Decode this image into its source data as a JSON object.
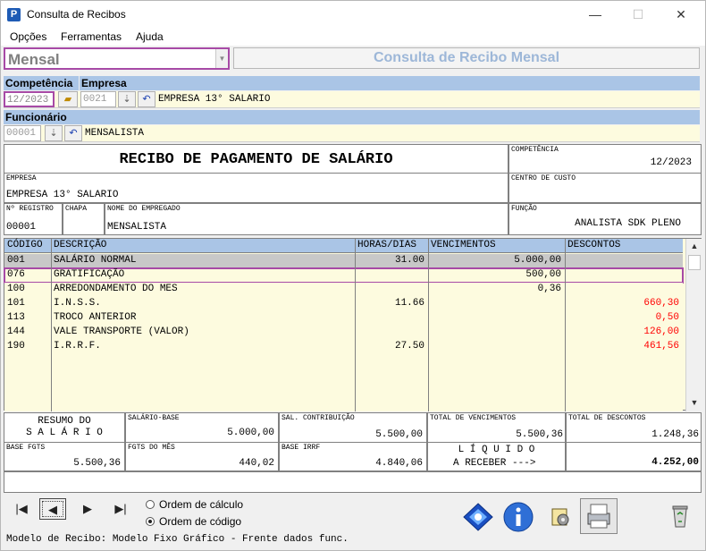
{
  "window": {
    "title": "Consulta de Recibos",
    "minimize": "—",
    "maximize": "☐",
    "close": "✕",
    "app_icon": "P"
  },
  "menu": [
    "Opções",
    "Ferramentas",
    "Ajuda"
  ],
  "period_type": {
    "value": "Mensal"
  },
  "header_title": "Consulta de Recibo Mensal",
  "labels": {
    "competencia": "Competência",
    "empresa": "Empresa",
    "funcionario": "Funcionário"
  },
  "competencia": {
    "value": "12/2023"
  },
  "empresa": {
    "code": "0021",
    "name": "EMPRESA 13° SALARIO"
  },
  "funcionario": {
    "code": "00001",
    "name": "MENSALISTA"
  },
  "receipt": {
    "title": "RECIBO DE PAGAMENTO DE SALÁRIO",
    "competencia_label": "COMPETÊNCIA",
    "competencia_value": "12/2023",
    "empresa_label": "EMPRESA",
    "empresa_value": "EMPRESA 13° SALARIO",
    "centro_label": "CENTRO DE CUSTO",
    "registro_label": "Nº REGISTRO",
    "registro_value": "00001",
    "chapa_label": "CHAPA",
    "nome_label": "NOME DO EMPREGADO",
    "nome_value": "MENSALISTA",
    "funcao_label": "FUNÇÃO",
    "funcao_value": "ANALISTA SDK PLENO"
  },
  "table": {
    "headers": [
      "CÓDIGO",
      "DESCRIÇÃO",
      "HORAS/DIAS",
      "VENCIMENTOS",
      "DESCONTOS"
    ],
    "rows": [
      {
        "code": "001",
        "desc": "SALÁRIO NORMAL",
        "hours": "31.00",
        "venc": "5.000,00",
        "desc_val": ""
      },
      {
        "code": "076",
        "desc": "GRATIFICAÇÃO",
        "hours": "",
        "venc": "500,00",
        "desc_val": ""
      },
      {
        "code": "100",
        "desc": "ARREDONDAMENTO DO MES",
        "hours": "",
        "venc": "0,36",
        "desc_val": ""
      },
      {
        "code": "101",
        "desc": "I.N.S.S.",
        "hours": "11.66",
        "venc": "",
        "desc_val": "660,30"
      },
      {
        "code": "113",
        "desc": "TROCO ANTERIOR",
        "hours": "",
        "venc": "",
        "desc_val": "0,50"
      },
      {
        "code": "144",
        "desc": "VALE TRANSPORTE (VALOR)",
        "hours": "",
        "venc": "",
        "desc_val": "126,00"
      },
      {
        "code": "190",
        "desc": "I.R.R.F.",
        "hours": "27.50",
        "venc": "",
        "desc_val": "461,56"
      }
    ]
  },
  "summary": {
    "resumo_line1": "RESUMO DO",
    "resumo_line2": "S A L Á R I O",
    "salario_base_label": "SALÁRIO-BASE",
    "salario_base_value": "5.000,00",
    "sal_contrib_label": "SAL. CONTRIBUIÇÃO",
    "sal_contrib_value": "5.500,00",
    "total_venc_label": "TOTAL DE VENCIMENTOS",
    "total_venc_value": "5.500,36",
    "total_desc_label": "TOTAL DE DESCONTOS",
    "total_desc_value": "1.248,36",
    "base_fgts_label": "BASE FGTS",
    "base_fgts_value": "5.500,36",
    "fgts_mes_label": "FGTS DO MÊS",
    "fgts_mes_value": "440,02",
    "base_irrf_label": "BASE IRRF",
    "base_irrf_value": "4.840,06",
    "liquido_line1": "L Í Q U I D O",
    "liquido_line2": "A RECEBER --->",
    "liquido_value": "4.252,00"
  },
  "nav": {
    "first": "|◀",
    "prev": "◀",
    "next": "▶",
    "last": "▶|"
  },
  "order": {
    "calc": "Ordem de cálculo",
    "code": "Ordem de código",
    "selected": "code"
  },
  "status": "Modelo de Recibo: Modelo Fixo Gráfico - Frente dados func.",
  "colors": {
    "accent_label": "#aac5e6",
    "highlight": "#a74aa6",
    "red_value": "#ff0000",
    "yellow_row": "#fdfbdf"
  }
}
